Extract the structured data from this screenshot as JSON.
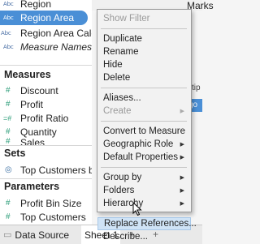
{
  "data_pane": {
    "dimensions": [
      {
        "type": "Abc",
        "label": "Region",
        "italic": false
      },
      {
        "type": "Abc",
        "label": "Region Area",
        "italic": false,
        "selected": true
      },
      {
        "type": "Abc",
        "label": "Region Area Calc",
        "italic": false
      },
      {
        "type": "Abc",
        "label": "Measure Names",
        "italic": true
      }
    ],
    "measures_header": "Measures",
    "measures": [
      {
        "icon": "#",
        "label": "Discount"
      },
      {
        "icon": "#",
        "label": "Profit"
      },
      {
        "icon": "=#",
        "label": "Profit Ratio"
      },
      {
        "icon": "#",
        "label": "Quantity"
      },
      {
        "icon": "#",
        "label": "Sales"
      }
    ],
    "sets_header": "Sets",
    "sets": [
      {
        "icon": "◎",
        "label": "Top Customers b"
      }
    ],
    "parameters_header": "Parameters",
    "parameters": [
      {
        "icon": "#",
        "label": "Profit Bin Size"
      },
      {
        "icon": "#",
        "label": "Top Customers"
      }
    ]
  },
  "tabs": {
    "data_source": "Data Source",
    "sheet": "Sheet 1",
    "new_icons": [
      "+",
      "+"
    ]
  },
  "background": {
    "marks_title": "Marks",
    "fragment_tip": "tip",
    "fragment_go": "go"
  },
  "context_menu": {
    "items": [
      {
        "label": "Show Filter",
        "disabled": true,
        "submenu": false
      },
      {
        "separator": true
      },
      {
        "label": "Duplicate",
        "disabled": false,
        "submenu": false
      },
      {
        "label": "Rename",
        "disabled": false,
        "submenu": false
      },
      {
        "label": "Hide",
        "disabled": false,
        "submenu": false
      },
      {
        "label": "Delete",
        "disabled": false,
        "submenu": false
      },
      {
        "separator": true
      },
      {
        "label": "Aliases...",
        "disabled": false,
        "submenu": false
      },
      {
        "label": "Create",
        "disabled": true,
        "submenu": true
      },
      {
        "separator": true
      },
      {
        "label": "Convert to Measure",
        "disabled": false,
        "submenu": false
      },
      {
        "label": "Geographic Role",
        "disabled": false,
        "submenu": true
      },
      {
        "label": "Default Properties",
        "disabled": false,
        "submenu": true
      },
      {
        "separator": true
      },
      {
        "label": "Group by",
        "disabled": false,
        "submenu": true
      },
      {
        "label": "Folders",
        "disabled": false,
        "submenu": true
      },
      {
        "label": "Hierarchy",
        "disabled": false,
        "submenu": true
      },
      {
        "separator": true
      },
      {
        "label": "Replace References...",
        "disabled": false,
        "submenu": false,
        "highlighted": true
      },
      {
        "label": "Describe...",
        "disabled": false,
        "submenu": false
      }
    ]
  },
  "colors": {
    "selection": "#4a8fd6",
    "measure_icon": "#2e9e7a",
    "menu_highlight": "#cfe3f6"
  }
}
